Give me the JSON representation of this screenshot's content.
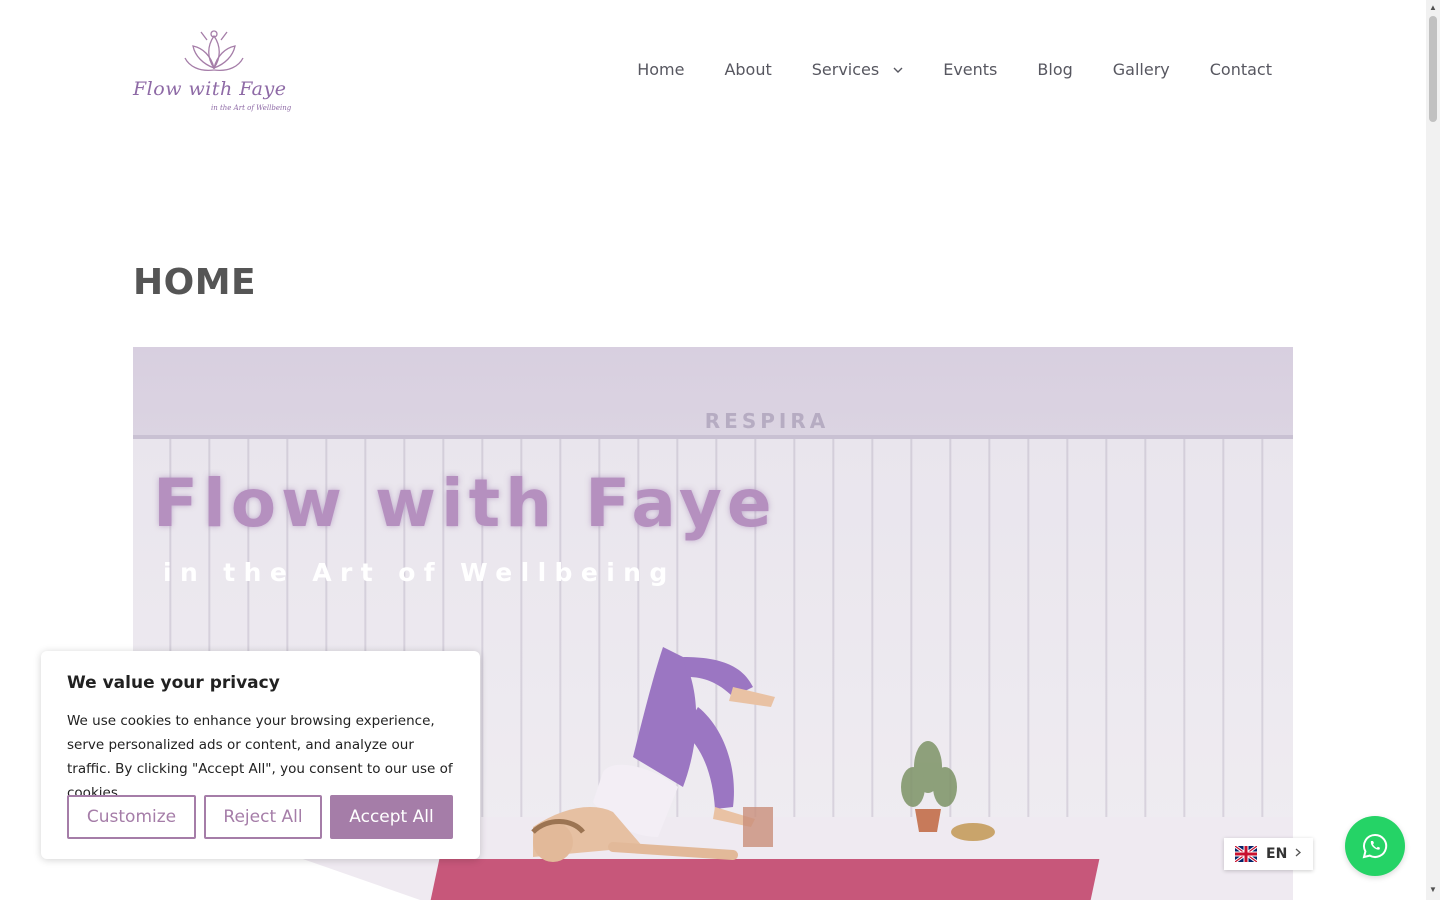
{
  "site": {
    "logo_title": "Flow with Faye",
    "logo_subtitle": "in the Art of Wellbeing"
  },
  "nav": {
    "items": [
      {
        "label": "Home"
      },
      {
        "label": "About"
      },
      {
        "label": "Services",
        "has_dropdown": true
      },
      {
        "label": "Events"
      },
      {
        "label": "Blog"
      },
      {
        "label": "Gallery"
      },
      {
        "label": "Contact"
      }
    ]
  },
  "page": {
    "title": "HOME"
  },
  "hero": {
    "title": "Flow with Faye",
    "subtitle": "in the Art of Wellbeing",
    "wall_sign": "RESPIRA"
  },
  "cookie": {
    "title": "We value your privacy",
    "text": "We use cookies to enhance your browsing experience, serve personalized ads or content, and analyze our traffic. By clicking \"Accept All\", you consent to our use of cookies.",
    "customize_label": "Customize",
    "reject_label": "Reject All",
    "accept_label": "Accept All"
  },
  "language": {
    "code": "EN"
  },
  "colors": {
    "accent": "#a57da8",
    "nav_text": "#575760",
    "whatsapp": "#25d366",
    "hero_title": "#b590bf"
  },
  "icons": [
    "lotus-logo-icon",
    "chevron-down-icon",
    "whatsapp-icon",
    "uk-flag-icon",
    "chevron-right-icon"
  ]
}
